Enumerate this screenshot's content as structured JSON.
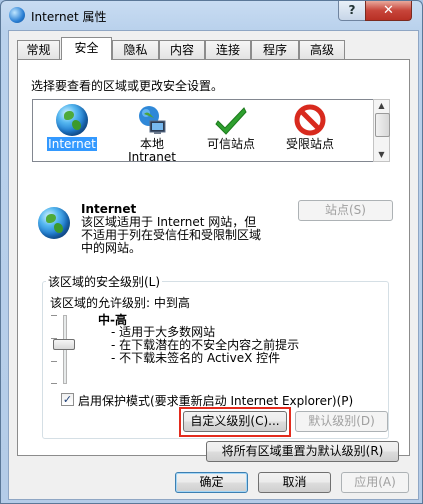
{
  "window": {
    "title": "Internet 属性",
    "help_label": "?",
    "close_label": "✕",
    "icon": "internet-globe-icon"
  },
  "tabs": [
    {
      "label": "常规",
      "active": false
    },
    {
      "label": "安全",
      "active": true
    },
    {
      "label": "隐私",
      "active": false
    },
    {
      "label": "内容",
      "active": false
    },
    {
      "label": "连接",
      "active": false
    },
    {
      "label": "程序",
      "active": false
    },
    {
      "label": "高级",
      "active": false
    }
  ],
  "security": {
    "instruction": "选择要查看的区域或更改安全设置。",
    "zones": [
      {
        "label_line1": "Internet",
        "label_line2": "",
        "icon": "globe-icon",
        "selected": true
      },
      {
        "label_line1": "本地",
        "label_line2": "Intranet",
        "icon": "local-intranet-icon",
        "selected": false
      },
      {
        "label_line1": "可信站点",
        "label_line2": "",
        "icon": "trusted-check-icon",
        "selected": false
      },
      {
        "label_line1": "受限站点",
        "label_line2": "",
        "icon": "restricted-no-icon",
        "selected": false
      }
    ],
    "zone_info": {
      "name": "Internet",
      "desc_lines": [
        "该区域适用于 Internet 网站，但",
        "不适用于列在受信任和受限制区域",
        "中的网站。"
      ],
      "sites_button": "站点(S)"
    },
    "level_group": {
      "title": "该区域的安全级别(L)",
      "allowed_label": "该区域的允许级别: 中到高",
      "level_name": "中-高",
      "bullets": [
        "- 适用于大多数网站",
        "- 在下载潜在的不安全内容之前提示",
        "- 不下载未签名的 ActiveX 控件"
      ],
      "slider_level": "中-高",
      "protected_mode_label": "启用保护模式(要求重新启动 Internet Explorer)(P)",
      "protected_mode_checked": true,
      "custom_level_button": "自定义级别(C)...",
      "default_level_button": "默认级别(D)"
    },
    "reset_all_button": "将所有区域重置为默认级别(R)"
  },
  "footer": {
    "ok": "确定",
    "cancel": "取消",
    "apply": "应用(A)"
  },
  "colors": {
    "highlight_box": "#e32b1d",
    "annotation_arrow": "#e32b1d",
    "selection": "#3399ff"
  }
}
